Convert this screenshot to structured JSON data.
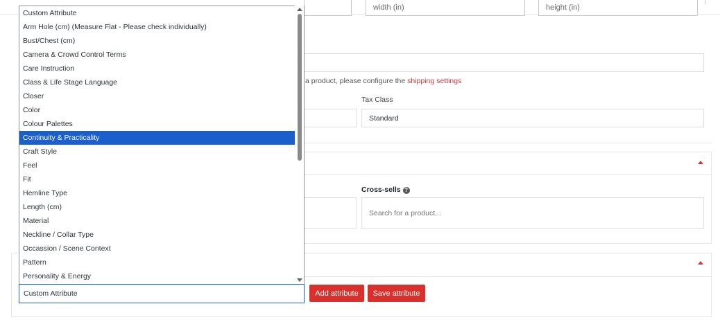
{
  "dimensions": {
    "width_placeholder": "width (in)",
    "height_placeholder": "height (in)"
  },
  "shipping": {
    "note_prefix": "a product, please configure the ",
    "link_text": "shipping settings"
  },
  "tax": {
    "label": "Tax Class",
    "value": "Standard"
  },
  "linked": {
    "crosssells_label": "Cross-sells",
    "help_icon": "?",
    "crosssells_placeholder": "Search for a product..."
  },
  "attributes": {
    "options": [
      "Custom Attribute",
      "Arm Hole (cm) (Measure Flat - Please check individually)",
      "Bust/Chest (cm)",
      "Camera & Crowd Control Terms",
      "Care Instruction",
      "Class & Life Stage Language",
      "Closer",
      "Color",
      "Colour Palettes",
      "Continuity & Practicality",
      "Craft Style",
      "Feel",
      "Fit",
      "Hemline Type",
      "Length (cm)",
      "Material",
      "Neckline / Collar Type",
      "Occassion / Scene Context",
      "Pattern",
      "Personality & Energy"
    ],
    "highlighted_index": 9,
    "selected_value": "Custom Attribute",
    "add_label": "Add attribute",
    "save_label": "Save attribute"
  },
  "colors": {
    "accent": "#d9302c",
    "highlight": "#1a5fcc",
    "link": "#d63638"
  },
  "icons": [
    "caret-up-icon",
    "help-icon",
    "scroll-up-icon",
    "scroll-down-icon"
  ]
}
